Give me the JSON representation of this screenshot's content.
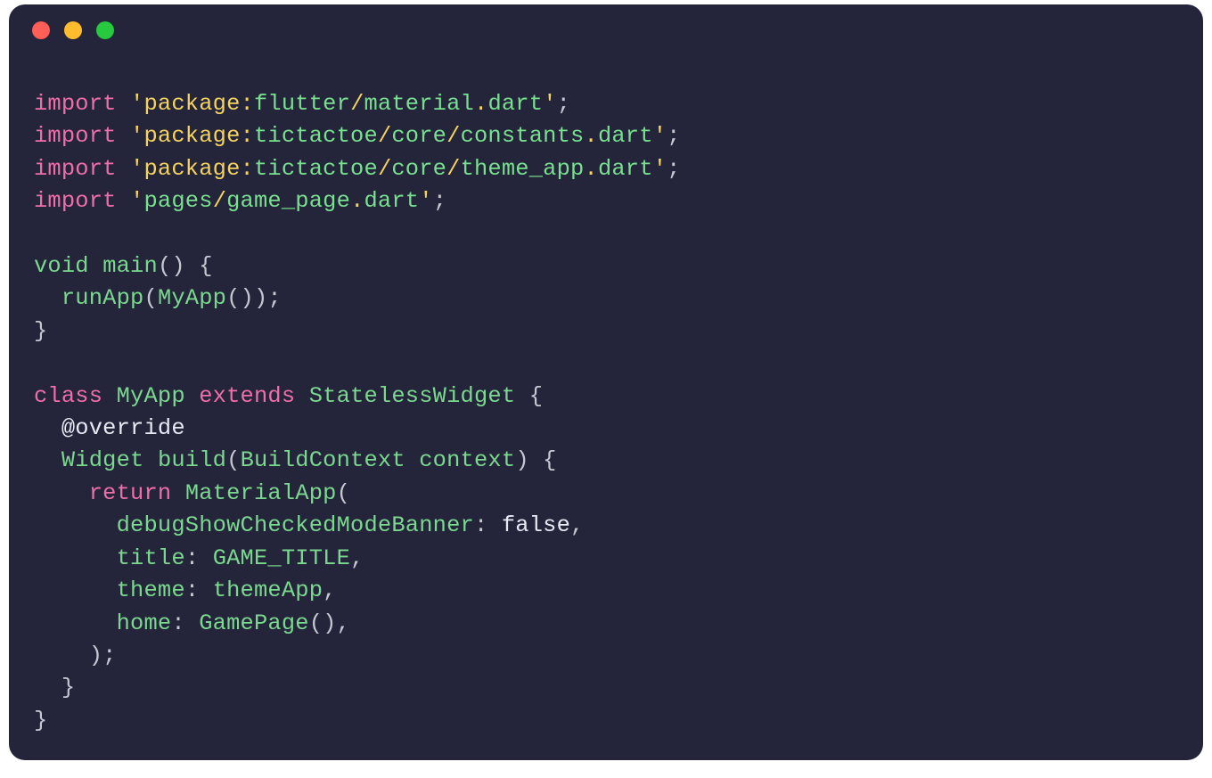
{
  "code": {
    "lines": [
      {
        "kind": "import",
        "kw": "import",
        "q1": "'",
        "path_pre": "package:",
        "path_a": "flutter",
        "sep1": "/",
        "path_b": "material",
        "dot": ".",
        "ext": "dart",
        "q2": "'",
        "semi": ";"
      },
      {
        "kind": "import",
        "kw": "import",
        "q1": "'",
        "path_pre": "package:",
        "path_a": "tictactoe",
        "sep1": "/",
        "path_b": "core",
        "sep2": "/",
        "path_c": "constants",
        "dot": ".",
        "ext": "dart",
        "q2": "'",
        "semi": ";"
      },
      {
        "kind": "import",
        "kw": "import",
        "q1": "'",
        "path_pre": "package:",
        "path_a": "tictactoe",
        "sep1": "/",
        "path_b": "core",
        "sep2": "/",
        "path_c": "theme_app",
        "dot": ".",
        "ext": "dart",
        "q2": "'",
        "semi": ";"
      },
      {
        "kind": "import",
        "kw": "import",
        "q1": "'",
        "path_a": "pages",
        "sep1": "/",
        "path_b": "game_page",
        "dot": ".",
        "ext": "dart",
        "q2": "'",
        "semi": ";"
      },
      {
        "kind": "blank"
      },
      {
        "kind": "line",
        "tokens": [
          [
            "t",
            "void"
          ],
          [
            "d",
            " "
          ],
          [
            "fn",
            "main"
          ],
          [
            "p",
            "() {"
          ]
        ]
      },
      {
        "kind": "line",
        "tokens": [
          [
            "d",
            "  "
          ],
          [
            "fn",
            "runApp"
          ],
          [
            "p",
            "("
          ],
          [
            "fn",
            "MyApp"
          ],
          [
            "p",
            "());"
          ]
        ]
      },
      {
        "kind": "line",
        "tokens": [
          [
            "p",
            "}"
          ]
        ]
      },
      {
        "kind": "blank"
      },
      {
        "kind": "line",
        "tokens": [
          [
            "k",
            "class"
          ],
          [
            "d",
            " "
          ],
          [
            "t",
            "MyApp"
          ],
          [
            "d",
            " "
          ],
          [
            "k",
            "extends"
          ],
          [
            "d",
            " "
          ],
          [
            "t",
            "StatelessWidget"
          ],
          [
            "d",
            " "
          ],
          [
            "p",
            "{"
          ]
        ]
      },
      {
        "kind": "line",
        "tokens": [
          [
            "d",
            "  "
          ],
          [
            "ann",
            "@override"
          ]
        ]
      },
      {
        "kind": "line",
        "tokens": [
          [
            "d",
            "  "
          ],
          [
            "t",
            "Widget"
          ],
          [
            "d",
            " "
          ],
          [
            "fn",
            "build"
          ],
          [
            "p",
            "("
          ],
          [
            "t",
            "BuildContext"
          ],
          [
            "d",
            " "
          ],
          [
            "fn",
            "context"
          ],
          [
            "p",
            ") {"
          ]
        ]
      },
      {
        "kind": "line",
        "tokens": [
          [
            "d",
            "    "
          ],
          [
            "k",
            "return"
          ],
          [
            "d",
            " "
          ],
          [
            "fn",
            "MaterialApp"
          ],
          [
            "p",
            "("
          ]
        ]
      },
      {
        "kind": "line",
        "tokens": [
          [
            "d",
            "      "
          ],
          [
            "fn",
            "debugShowCheckedModeBanner"
          ],
          [
            "p",
            ": "
          ],
          [
            "d",
            "false"
          ],
          [
            "p",
            ","
          ]
        ]
      },
      {
        "kind": "line",
        "tokens": [
          [
            "d",
            "      "
          ],
          [
            "fn",
            "title"
          ],
          [
            "p",
            ": "
          ],
          [
            "fn",
            "GAME_TITLE"
          ],
          [
            "p",
            ","
          ]
        ]
      },
      {
        "kind": "line",
        "tokens": [
          [
            "d",
            "      "
          ],
          [
            "fn",
            "theme"
          ],
          [
            "p",
            ": "
          ],
          [
            "fn",
            "themeApp"
          ],
          [
            "p",
            ","
          ]
        ]
      },
      {
        "kind": "line",
        "tokens": [
          [
            "d",
            "      "
          ],
          [
            "fn",
            "home"
          ],
          [
            "p",
            ": "
          ],
          [
            "fn",
            "GamePage"
          ],
          [
            "p",
            "(),"
          ]
        ]
      },
      {
        "kind": "line",
        "tokens": [
          [
            "d",
            "    "
          ],
          [
            "p",
            ");"
          ]
        ]
      },
      {
        "kind": "line",
        "tokens": [
          [
            "d",
            "  "
          ],
          [
            "p",
            "}"
          ]
        ]
      },
      {
        "kind": "line",
        "tokens": [
          [
            "p",
            "}"
          ]
        ]
      }
    ]
  },
  "traffic_lights": [
    "close",
    "minimize",
    "zoom"
  ]
}
